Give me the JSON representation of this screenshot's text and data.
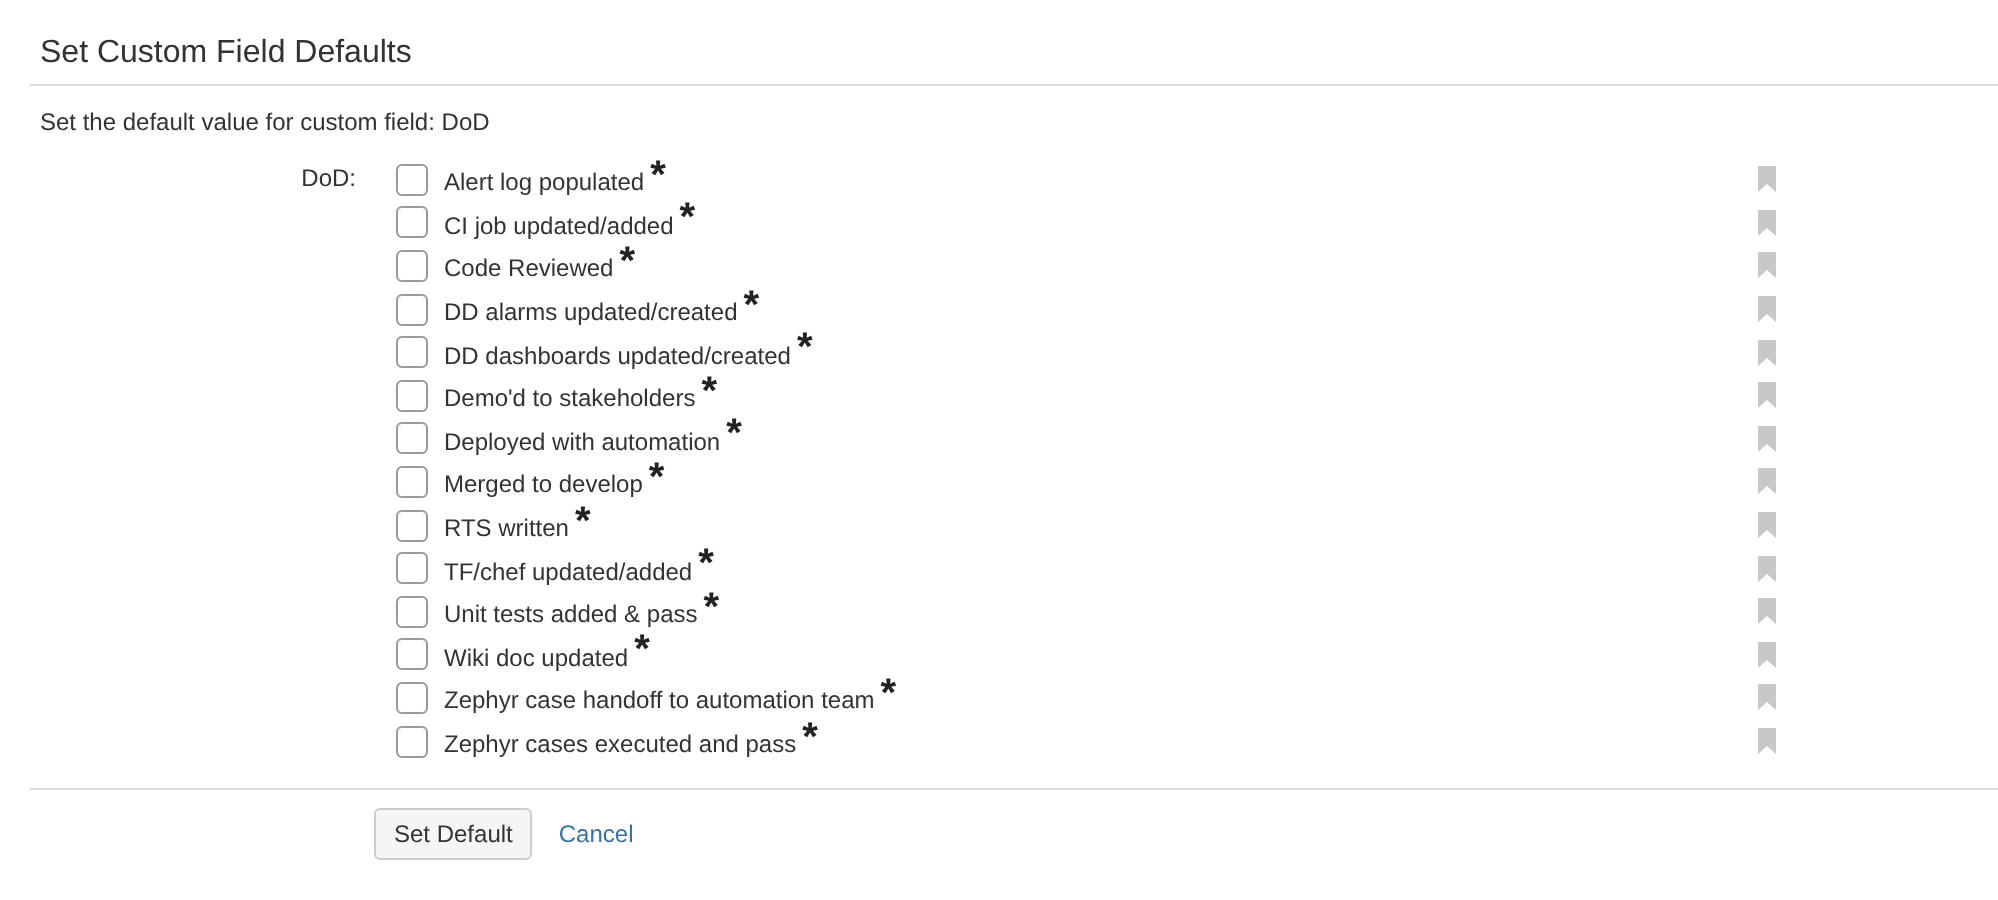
{
  "title": "Set Custom Field Defaults",
  "description": "Set the default value for custom field: DoD",
  "field_label": "DoD:",
  "options": [
    {
      "label": "Alert log populated",
      "mark": "*",
      "checked": false
    },
    {
      "label": "CI job updated/added",
      "mark": "*",
      "checked": false
    },
    {
      "label": "Code Reviewed",
      "mark": "*",
      "checked": false
    },
    {
      "label": "DD alarms updated/created",
      "mark": "*",
      "checked": false
    },
    {
      "label": "DD dashboards updated/created",
      "mark": "*",
      "checked": false
    },
    {
      "label": "Demo'd to stakeholders",
      "mark": "*",
      "checked": false
    },
    {
      "label": "Deployed with automation",
      "mark": "*",
      "checked": false
    },
    {
      "label": "Merged to develop",
      "mark": "*",
      "checked": false
    },
    {
      "label": "RTS written",
      "mark": "*",
      "checked": false
    },
    {
      "label": "TF/chef updated/added",
      "mark": "*",
      "checked": false
    },
    {
      "label": "Unit tests added & pass",
      "mark": "*",
      "checked": false
    },
    {
      "label": "Wiki doc updated",
      "mark": "*",
      "checked": false
    },
    {
      "label": "Zephyr case handoff to automation team",
      "mark": "*",
      "checked": false
    },
    {
      "label": "Zephyr cases executed and pass",
      "mark": "*",
      "checked": false
    }
  ],
  "buttons": {
    "submit": "Set Default",
    "cancel": "Cancel"
  }
}
